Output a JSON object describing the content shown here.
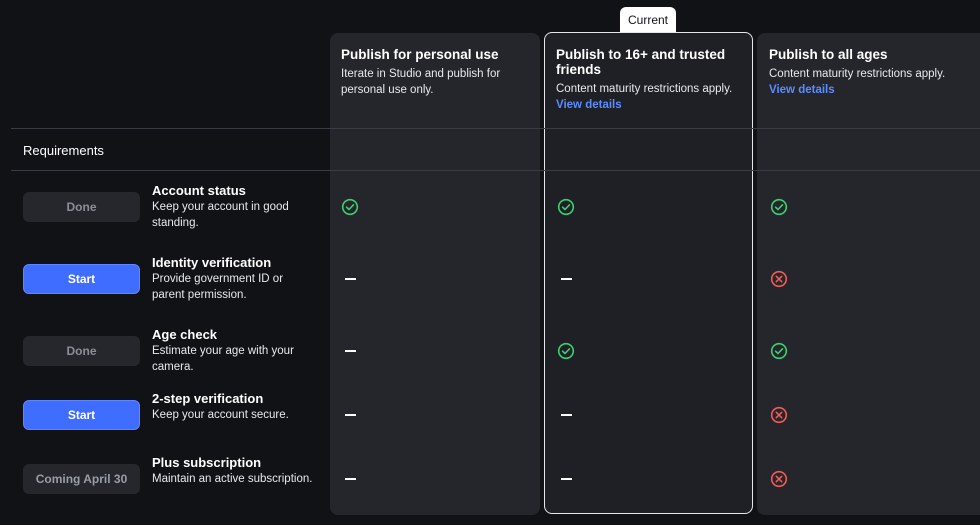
{
  "current_badge": "Current",
  "columns": [
    {
      "title": "Publish for personal use",
      "desc": "Iterate in Studio and publish for personal use only.",
      "link": ""
    },
    {
      "title": "Publish to 16+ and trusted friends",
      "desc": "Content maturity restrictions apply.",
      "link": "View details"
    },
    {
      "title": "Publish to all ages",
      "desc": "Content maturity restrictions apply.",
      "link": "View details"
    }
  ],
  "requirements_label": "Requirements",
  "rows": [
    {
      "button": "Done",
      "title": "Account status",
      "desc": "Keep your account in good standing.",
      "status": [
        "check",
        "check",
        "check"
      ]
    },
    {
      "button": "Start",
      "title": "Identity verification",
      "desc": "Provide government ID or parent permission.",
      "status": [
        "dash",
        "dash",
        "x"
      ]
    },
    {
      "button": "Done",
      "title": "Age check",
      "desc": "Estimate your age with your camera.",
      "status": [
        "dash",
        "check",
        "check"
      ]
    },
    {
      "button": "Start",
      "title": "2-step verification",
      "desc": "Keep your account secure.",
      "status": [
        "dash",
        "dash",
        "x"
      ]
    },
    {
      "button": "Coming April 30",
      "title": "Plus subscription",
      "desc": "Maintain an active subscription.",
      "status": [
        "dash",
        "dash",
        "x"
      ]
    }
  ],
  "colors": {
    "check": "#3ecf6e",
    "x": "#f25c54",
    "accent": "#3f6dff",
    "link": "#5b8cff"
  },
  "icons": {
    "check": "check-circle-icon",
    "x": "x-circle-icon",
    "dash": "dash-icon"
  }
}
